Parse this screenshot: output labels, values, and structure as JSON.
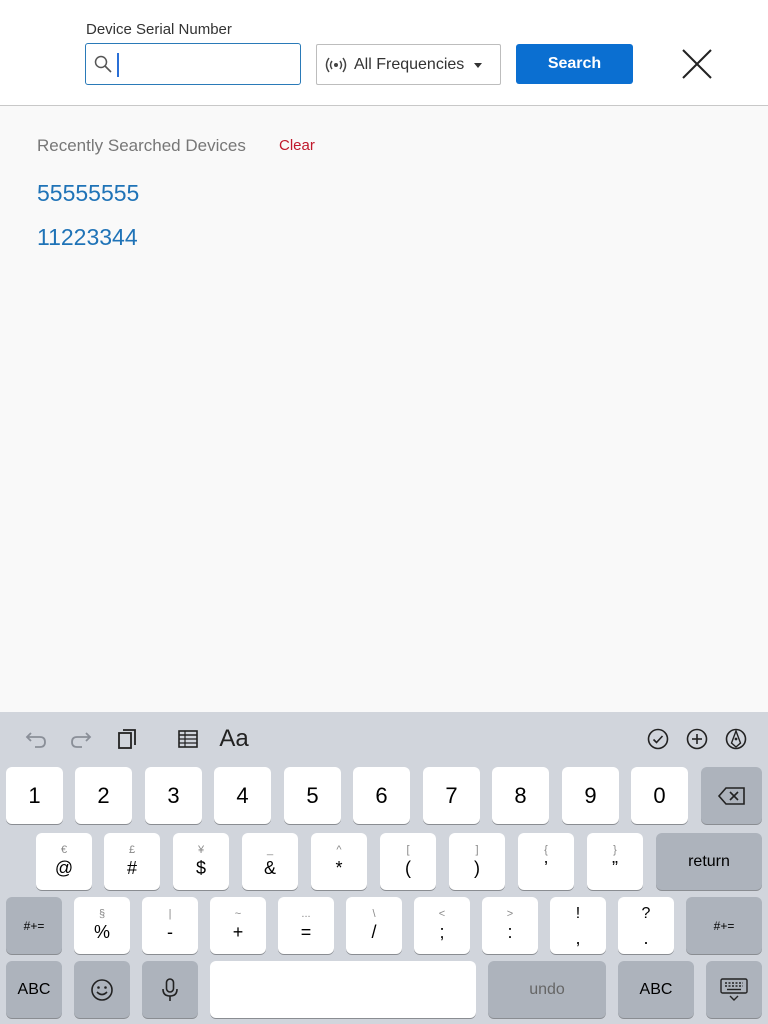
{
  "header": {
    "field_label": "Device Serial Number",
    "search_value": "",
    "frequency_select": "All Frequencies",
    "search_button": "Search"
  },
  "recent": {
    "title": "Recently Searched Devices",
    "clear": "Clear",
    "items": [
      "55555555",
      "11223344"
    ]
  },
  "keyboard": {
    "toolbar": {
      "left": [
        "undo-icon",
        "redo-icon",
        "paste-icon",
        "table-icon",
        "format-text"
      ],
      "format_label": "Aa",
      "right": [
        "check-circle-icon",
        "add-circle-icon",
        "pen-icon"
      ]
    },
    "row1": [
      "1",
      "2",
      "3",
      "4",
      "5",
      "6",
      "7",
      "8",
      "9",
      "0"
    ],
    "row2": [
      {
        "main": "@",
        "sub": "€"
      },
      {
        "main": "#",
        "sub": "£"
      },
      {
        "main": "$",
        "sub": "¥"
      },
      {
        "main": "&",
        "sub": "_"
      },
      {
        "main": "*",
        "sub": "^"
      },
      {
        "main": "(",
        "sub": "["
      },
      {
        "main": ")",
        "sub": "]"
      },
      {
        "main": "’",
        "sub": "{"
      },
      {
        "main": "”",
        "sub": "}"
      }
    ],
    "return_label": "return",
    "row3": [
      {
        "main": "%",
        "sub": "§"
      },
      {
        "main": "-",
        "sub": "|"
      },
      {
        "main": "+",
        "sub": "~"
      },
      {
        "main": "=",
        "sub": "..."
      },
      {
        "main": "/",
        "sub": "\\"
      },
      {
        "main": ";",
        "sub": "<"
      },
      {
        "main": ":",
        "sub": ">"
      },
      {
        "main": ",",
        "sub": "!"
      },
      {
        "main": ".",
        "sub": "?"
      }
    ],
    "shift_left": "#+=",
    "shift_right": "#+=",
    "abc_left": "ABC",
    "abc_right": "ABC",
    "undo_label": "undo"
  }
}
